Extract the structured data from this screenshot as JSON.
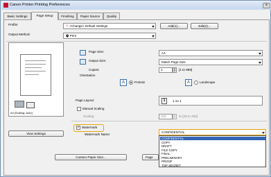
{
  "window": {
    "title": "Canon Printer Printing Preferences",
    "close_glyph": "×"
  },
  "tabs": [
    "Basic Settings",
    "Page Setup",
    "Finishing",
    "Paper Source",
    "Quality"
  ],
  "profile": {
    "label": "Profile:",
    "value": "<Change> Default Settings",
    "add_button": "Add(1)...",
    "edit_button": "Edit(2)..."
  },
  "output_method": {
    "label": "Output Method:",
    "value": "Print"
  },
  "page_size": {
    "label": "Page Size:",
    "value": "A4"
  },
  "output_size": {
    "label": "Output Size:",
    "value": "Match Page Size"
  },
  "copies": {
    "label": "Copies:",
    "value": "1",
    "range": "[1 to 999]"
  },
  "orientation": {
    "label": "Orientation",
    "portrait": "Portrait",
    "landscape": "Landscape",
    "selected": "portrait"
  },
  "page_layout": {
    "label": "Page Layout:",
    "value": "1 on 1",
    "icon_text": "1"
  },
  "manual_scaling": {
    "label": "Manual Scaling",
    "checked": false
  },
  "scaling": {
    "label": "Scaling:",
    "value": "100",
    "range": "% [25 to 200]"
  },
  "preview": {
    "caption": "A4 [Scaling: Auto]"
  },
  "view_settings_button": "View Settings",
  "watermark": {
    "label": "Watermark",
    "checked": true,
    "name_label": "Watermark Name:",
    "value": "CONFIDENTIAL"
  },
  "watermark_options": [
    "CONFIDENTIAL",
    "COPY",
    "DRAFT",
    "FILE COPY",
    "FINAL",
    "PRELIMINARY",
    "PROOF",
    "TOP SECRET"
  ],
  "watermark_selected": "CONFIDENTIAL",
  "custom_paper_button": "Custom Paper Size...",
  "page_options_button": "Page",
  "colors": {
    "highlight": "#e8a10c",
    "selection": "#3264b4"
  }
}
